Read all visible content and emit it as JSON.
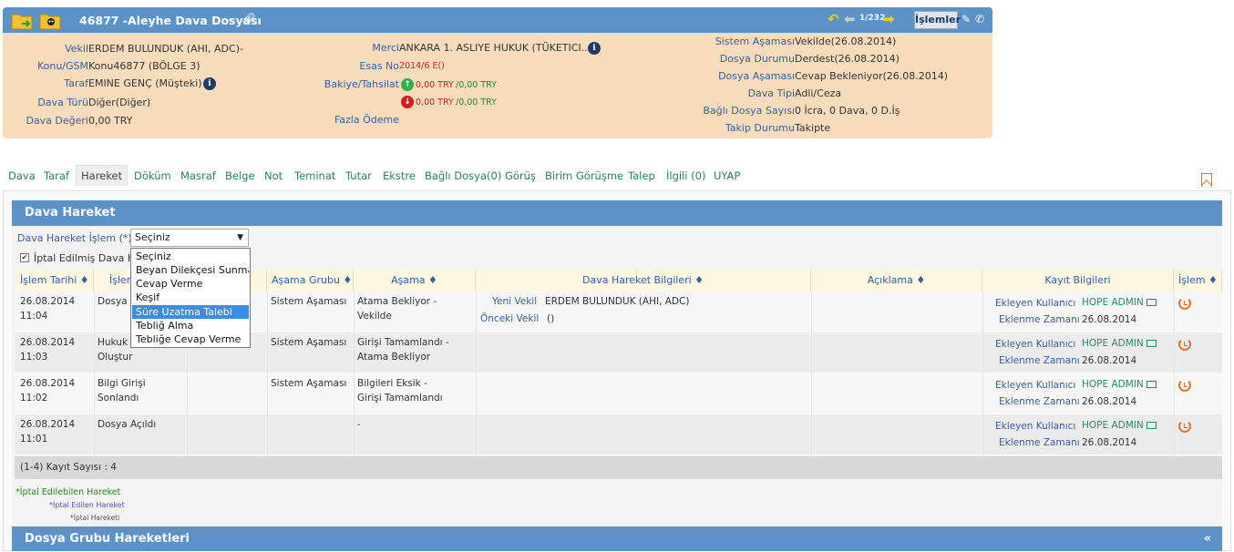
{
  "header": {
    "title": "46877 -Aleyhe Dava Dosyası",
    "pager": "1/232",
    "islemler": "İşlemler",
    "fields_left": [
      {
        "label": "Vekil",
        "value": "ERDEM BULUNDUK (AHI, ADC)-"
      },
      {
        "label": "Konu/GSM",
        "value": "Konu46877 (BÖLGE 3)"
      },
      {
        "label": "Taraf",
        "value": "EMINE GENÇ (Müşteki)"
      },
      {
        "label": "Dava Türü",
        "value": "Diğer(Diğer)"
      },
      {
        "label": "Dava Değeri",
        "value": "0,00 TRY"
      }
    ],
    "fields_mid": {
      "merci_label": "Merci",
      "merci_value": "ANKARA 1. ASLIYE HUKUK (TÜKETICI...",
      "esas_label": "Esas No",
      "esas_value": "2014/6 E()",
      "bakiye_label": "Bakiye/Tahsilat",
      "bakiye_up_a": "0,00 TRY",
      "bakiye_up_b": "/0,00 TRY",
      "bakiye_down_a": "0,00 TRY",
      "bakiye_down_b": "/0,00 TRY",
      "fazla_label": "Fazla Ödeme"
    },
    "fields_right": [
      {
        "label": "Sistem Aşaması",
        "value": "Vekilde(26.08.2014)"
      },
      {
        "label": "Dosya Durumu",
        "value": "Derdest(26.08.2014)"
      },
      {
        "label": "Dosya Aşaması",
        "value": "Cevap Bekleniyor(26.08.2014)"
      },
      {
        "label": "Dava Tipi",
        "value": "Adli/Ceza"
      },
      {
        "label": "Bağlı Dosya Sayısı",
        "value": "0 İcra, 0 Dava, 0 D.İş"
      },
      {
        "label": "Takip Durumu",
        "value": "Takipte"
      }
    ]
  },
  "tabs": [
    "Dava",
    "Taraf",
    "Hareket",
    "Döküm",
    "Masraf",
    "Belge",
    "Not",
    "Teminat",
    "Tutar",
    "Ekstre",
    "Bağlı Dosya(0)",
    "Görüş",
    "Birim Görüşme",
    "Talep",
    "İlgili (0)",
    "UYAP"
  ],
  "panel1": {
    "title": "Dava Hareket",
    "form_label": "Dava Hareket İşlem (*)",
    "select_value": "Seçiniz",
    "checkbox_label": "İptal Edilmiş Dava H"
  },
  "dropdown": {
    "options": [
      "Seçiniz",
      "Beyan Dilekçesi Sunma",
      "Cevap Verme",
      "Keşif",
      "Süre Uzatma Talebi",
      "Tebliğ Alma",
      "Tebliğe Cevap Verme"
    ],
    "selected_index": 4
  },
  "table": {
    "headers": [
      "İşlem Tarihi ♦",
      "İşlem",
      "",
      "Aşama Grubu ♦",
      "Aşama ♦",
      "Dava Hareket Bilgileri ♦",
      "Açıklama ♦",
      "Kayıt Bilgileri",
      "İşlem ♦"
    ],
    "rows": [
      {
        "date": "26.08.2014",
        "time": "11:04",
        "islem": "Dosya A",
        "islem2": "",
        "grup": "Sistem Aşaması",
        "asama1": "Atama Bekliyor -",
        "asama2": "Vekilde",
        "bilgi1_label": "Yeni Vekil",
        "bilgi1_value": "ERDEM BULUNDUK (AHI, ADC)",
        "bilgi2_label": "Önceki Vekil",
        "bilgi2_value": "()",
        "kayit_label": "Ekleyen Kullanıcı",
        "kayit_user": "HOPE ADMIN",
        "zaman_label": "Eklenme Zamanı",
        "zaman": "26.08.2014"
      },
      {
        "date": "26.08.2014",
        "time": "11:03",
        "islem": "Hukuk D",
        "islem2": "Oluştur",
        "grup": "Sistem Aşaması",
        "asama1": "Girişi Tamamlandı -",
        "asama2": "Atama Bekliyor",
        "bilgi1_label": "",
        "bilgi1_value": "",
        "bilgi2_label": "",
        "bilgi2_value": "",
        "kayit_label": "Ekleyen Kullanıcı",
        "kayit_user": "HOPE ADMIN",
        "zaman_label": "Eklenme Zamanı",
        "zaman": "26.08.2014"
      },
      {
        "date": "26.08.2014",
        "time": "11:02",
        "islem": "Bilgi Girişi",
        "islem2": "Sonlandı",
        "grup": "Sistem Aşaması",
        "asama1": "Bilgileri Eksik -",
        "asama2": "Girişi Tamamlandı",
        "bilgi1_label": "",
        "bilgi1_value": "",
        "bilgi2_label": "",
        "bilgi2_value": "",
        "kayit_label": "Ekleyen Kullanıcı",
        "kayit_user": "HOPE ADMIN",
        "zaman_label": "Eklenme Zamanı",
        "zaman": "26.08.2014"
      },
      {
        "date": "26.08.2014",
        "time": "11:01",
        "islem": "Dosya Açıldı",
        "islem2": "",
        "grup": "",
        "asama1": "-",
        "asama2": "",
        "bilgi1_label": "",
        "bilgi1_value": "",
        "bilgi2_label": "",
        "bilgi2_value": "",
        "kayit_label": "Ekleyen Kullanıcı",
        "kayit_user": "HOPE ADMIN",
        "zaman_label": "Eklenme Zamanı",
        "zaman": "26.08.2014"
      }
    ],
    "footer": "(1-4) Kayıt Sayısı : 4"
  },
  "legend": {
    "iptal_edilebilen": "*İptal Edilebilen Hareket",
    "iptal_edilen": "*İptal Edilen Hareket",
    "iptal": "*İptal Hareketi"
  },
  "panel2": {
    "title": "Dosya Grubu Hareketleri",
    "collapse": "«"
  },
  "colors": {
    "header_bg": "#f9dcbc",
    "bar": "#5b93c9",
    "label": "#3a5e9a",
    "tab": "#2e7a6b",
    "accent": "#e8742a",
    "select_highlight": "#3a8de0"
  }
}
